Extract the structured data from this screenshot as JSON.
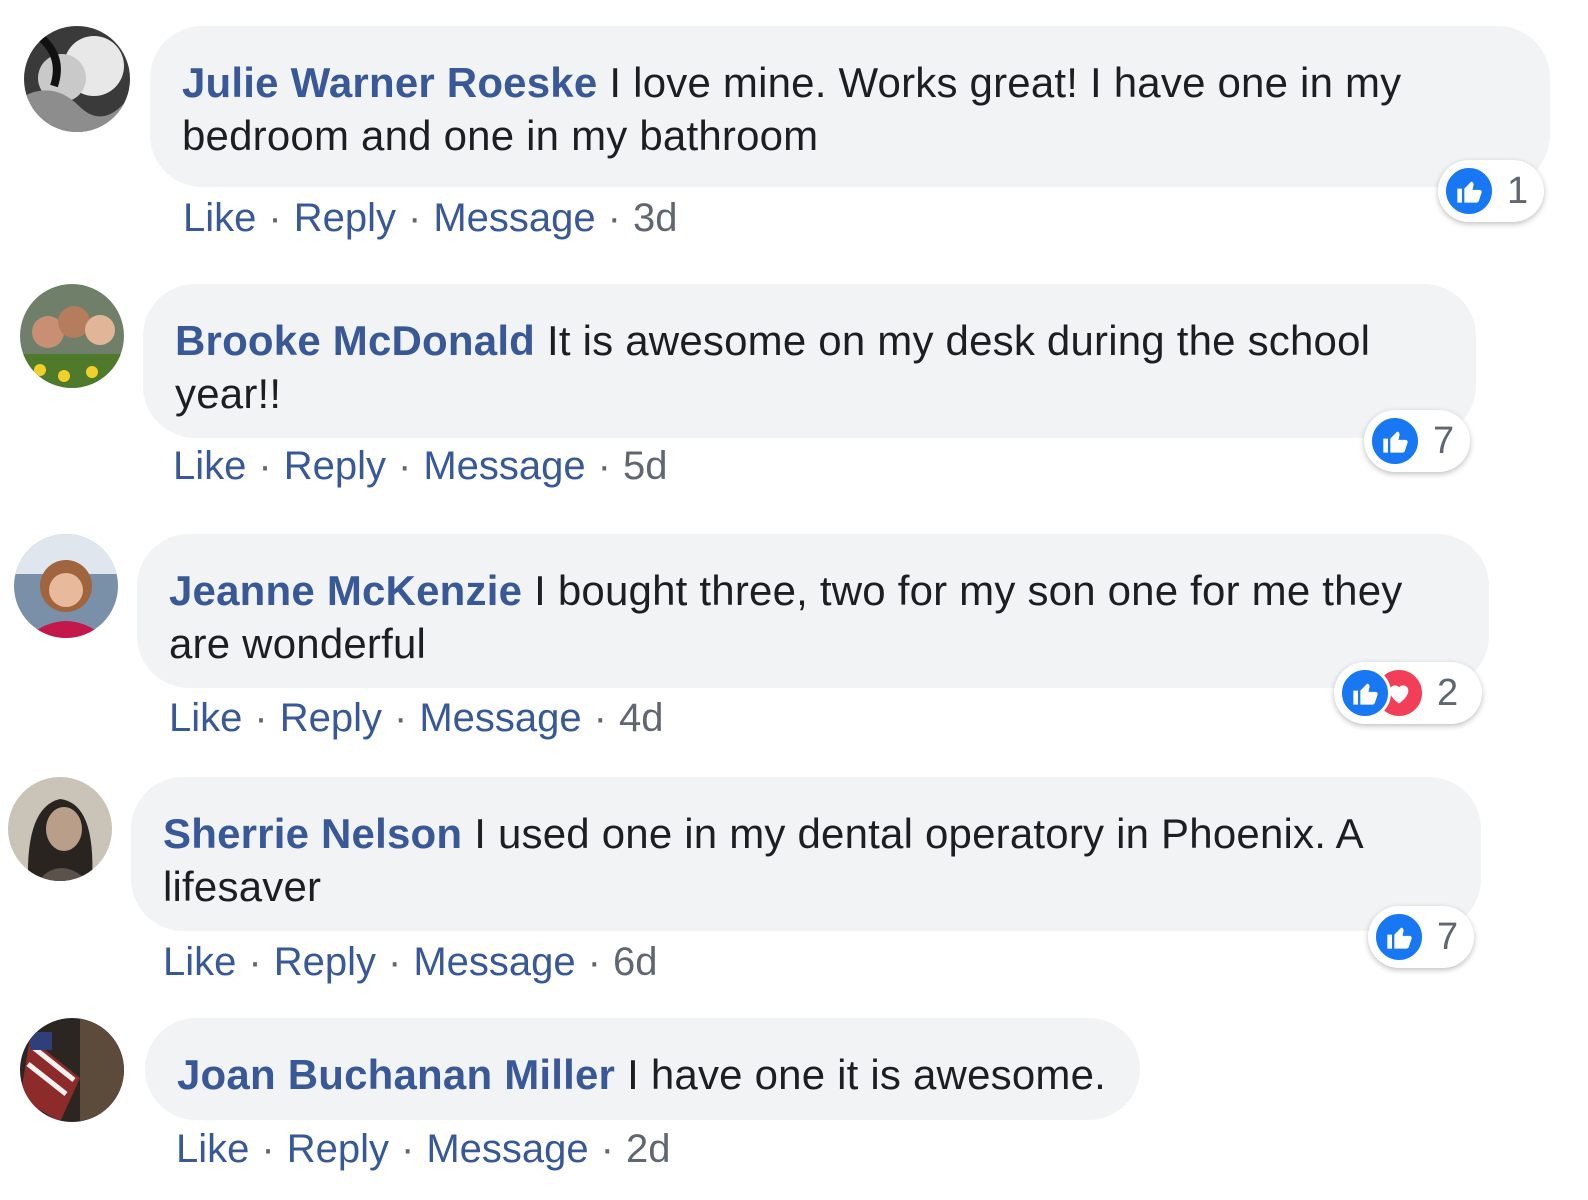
{
  "colors": {
    "author_link": "#385898",
    "bubble_bg": "#f2f3f5",
    "like_blue": "#1877f2",
    "love_red": "#f33e58",
    "meta_gray": "#606770"
  },
  "actions": {
    "like": "Like",
    "reply": "Reply",
    "message": "Message",
    "separator": "·"
  },
  "comments": [
    {
      "author": "Julie Warner Roeske",
      "text": "I love mine. Works great! I have one in my bedroom and one in my bathroom",
      "time": "3d",
      "reactions": [
        "like-icon"
      ],
      "reaction_count": "1"
    },
    {
      "author": "Brooke McDonald",
      "text": "It is awesome on my desk during the school year!!",
      "time": "5d",
      "reactions": [
        "like-icon"
      ],
      "reaction_count": "7"
    },
    {
      "author": "Jeanne McKenzie",
      "text": "I bought three, two for my son one for me they are wonderful",
      "time": "4d",
      "reactions": [
        "like-icon",
        "love-icon"
      ],
      "reaction_count": "2"
    },
    {
      "author": "Sherrie Nelson",
      "text": "I used one in my dental operatory in Phoenix. A lifesaver",
      "time": "6d",
      "reactions": [
        "like-icon"
      ],
      "reaction_count": "7"
    },
    {
      "author": "Joan Buchanan Miller",
      "text": "I have one it is awesome.",
      "time": "2d",
      "reactions": [],
      "reaction_count": ""
    }
  ]
}
